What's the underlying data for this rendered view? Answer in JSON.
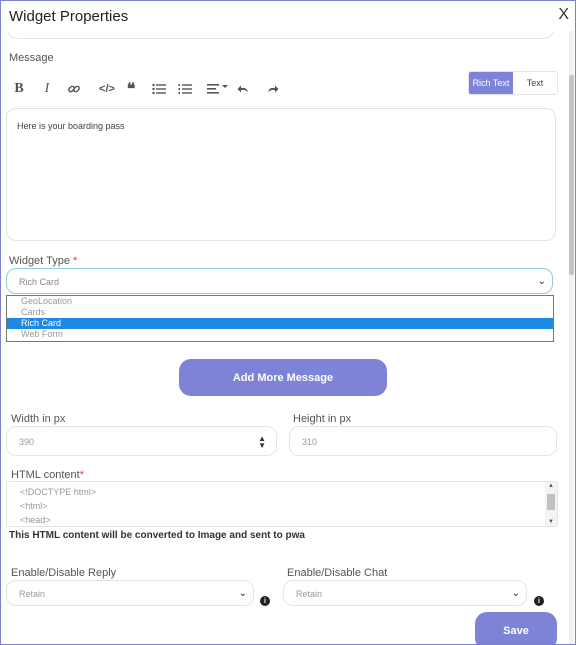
{
  "dialog": {
    "title": "Widget Properties",
    "close_label": "X"
  },
  "message": {
    "label": "Message",
    "mode_rich": "Rich Text",
    "mode_text": "Text",
    "content": "Here is your boarding pass"
  },
  "widget_type": {
    "label": "Widget Type",
    "required_mark": "*",
    "selected": "Rich Card",
    "options": [
      "GeoLocation",
      "Cards",
      "Rich Card",
      "Web Form"
    ]
  },
  "add_more_label": "Add More Message",
  "width": {
    "label": "Width in px",
    "value": "390"
  },
  "height": {
    "label": "Height in px",
    "value": "310"
  },
  "html_content": {
    "label": "HTML content",
    "required_mark": "*",
    "lines": [
      "<!DOCTYPE html>",
      "<html>",
      "<head>"
    ],
    "note": "This HTML content will be converted to Image and sent to pwa"
  },
  "reply": {
    "label": "Enable/Disable Reply",
    "value": "Retain"
  },
  "chat": {
    "label": "Enable/Disable Chat",
    "value": "Retain"
  },
  "save_label": "Save",
  "colors": {
    "accent": "#7d84d8",
    "selected_option": "#1e88e5",
    "required": "#e53935"
  }
}
